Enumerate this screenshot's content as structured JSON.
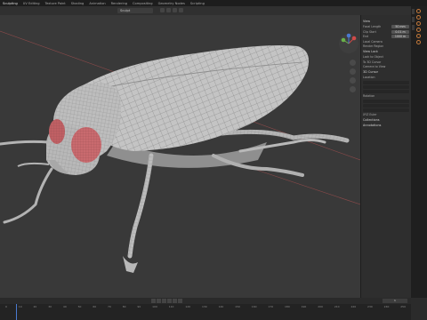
{
  "topbar": {
    "tabs": [
      "Sculpting",
      "UV Editing",
      "Texture Paint",
      "Shading",
      "Animation",
      "Rendering",
      "Compositing",
      "Geometry Nodes",
      "Scripting"
    ],
    "active_index": 0
  },
  "viewport_header": {
    "mode": "Sculpt"
  },
  "npanel": {
    "header": "View",
    "rows": [
      {
        "label": "Focal Length",
        "value": "50 mm"
      },
      {
        "label": "Clip Start",
        "value": "0.01 m"
      },
      {
        "label": "End",
        "value": "1000 m"
      }
    ],
    "local_camera": "Local Camera",
    "render_region": "Render Region",
    "view_lock": "View Lock",
    "lock_to_object": "Lock to Object",
    "lock_to_3d_cursor": "To 3D Cursor",
    "lock_camera_to_view": "Camera to View",
    "cursor_header": "3D Cursor",
    "location_label": "Location",
    "rotation_label": "Rotation",
    "rotation_mode": "XYZ Euler",
    "collections": "Collections",
    "annotations": "Annotations"
  },
  "timeline": {
    "frame": "1",
    "ticks": [
      "0",
      "10",
      "20",
      "30",
      "40",
      "50",
      "60",
      "70",
      "80",
      "90",
      "100",
      "110",
      "120",
      "130",
      "140",
      "150",
      "160",
      "170",
      "180",
      "190",
      "200",
      "210",
      "220",
      "230",
      "240",
      "250"
    ]
  },
  "colors": {
    "accent": "#4a7ad0",
    "eye": "#c96a6e",
    "mesh": "#b9b9b9",
    "wire": "#7a7a7a"
  }
}
